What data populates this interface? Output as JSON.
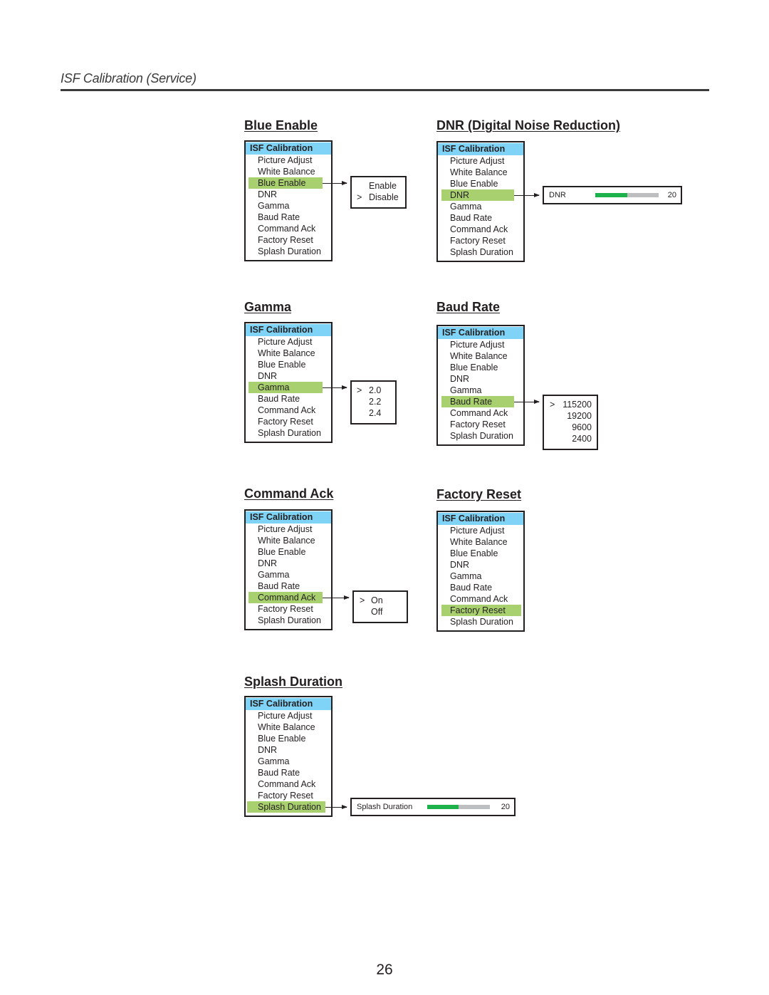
{
  "page": {
    "title": "ISF Calibration (Service)",
    "page_number": "26"
  },
  "menu": {
    "header": "ISF Calibration",
    "items": [
      "Picture Adjust",
      "White Balance",
      "Blue Enable",
      "DNR",
      "Gamma",
      "Baud Rate",
      "Command Ack",
      "Factory Reset",
      "Splash Duration"
    ]
  },
  "current_marker": ">",
  "colors": {
    "menu_header": "#7fd3f7",
    "highlight": "#a9d06f",
    "slider_fill": "#1db14b",
    "slider_track": "#bcbec0",
    "border": "#231f20"
  },
  "sections": [
    {
      "heading": "Blue Enable",
      "selected_item": "Blue Enable",
      "submenu": {
        "type": "list",
        "options": [
          {
            "label": "Enable",
            "current": false
          },
          {
            "label": "Disable",
            "current": true
          }
        ]
      }
    },
    {
      "heading": "DNR (Digital Noise Reduction)",
      "selected_item": "DNR",
      "submenu": {
        "type": "slider",
        "label": "DNR",
        "value": "20",
        "fill_fraction": 0.5
      }
    },
    {
      "heading": "Gamma",
      "selected_item": "Gamma",
      "submenu": {
        "type": "list",
        "options": [
          {
            "label": "2.0",
            "current": true
          },
          {
            "label": "2.2",
            "current": false
          },
          {
            "label": "2.4",
            "current": false
          }
        ]
      }
    },
    {
      "heading": "Baud Rate",
      "selected_item": "Baud Rate",
      "submenu": {
        "type": "list",
        "options": [
          {
            "label": "115200",
            "current": true
          },
          {
            "label": "19200",
            "current": false
          },
          {
            "label": "9600",
            "current": false
          },
          {
            "label": "2400",
            "current": false
          }
        ]
      }
    },
    {
      "heading": "Command Ack",
      "selected_item": "Command Ack",
      "submenu": {
        "type": "list",
        "options": [
          {
            "label": "On",
            "current": true
          },
          {
            "label": "Off",
            "current": false
          }
        ]
      }
    },
    {
      "heading": "Factory Reset",
      "selected_item": "Factory Reset",
      "submenu": null
    },
    {
      "heading": "Splash Duration",
      "selected_item": "Splash Duration",
      "submenu": {
        "type": "slider",
        "label": "Splash Duration",
        "value": "20",
        "fill_fraction": 0.5
      }
    }
  ]
}
